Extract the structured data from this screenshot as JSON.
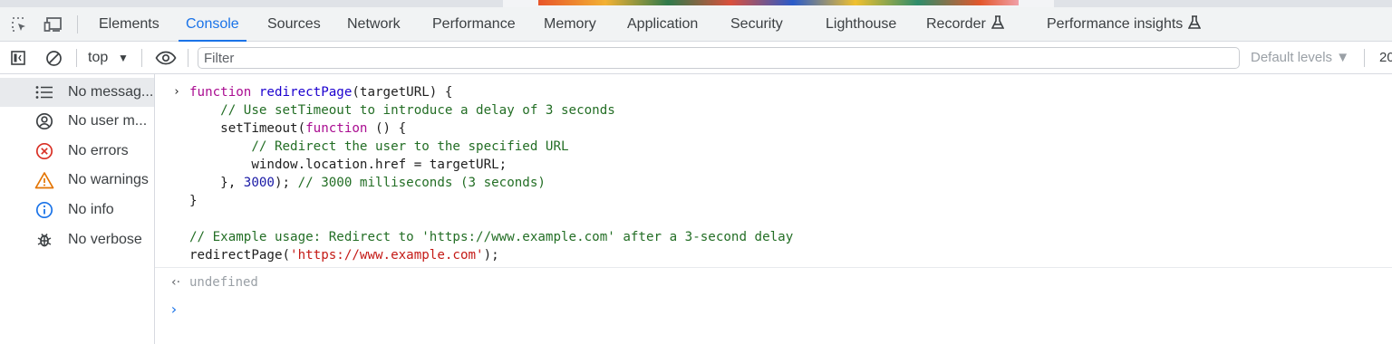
{
  "tabs": {
    "inspect_icon": "inspect-element-icon",
    "device_icon": "device-toolbar-icon",
    "items": [
      {
        "label": "Elements",
        "active": false
      },
      {
        "label": "Console",
        "active": true
      },
      {
        "label": "Sources",
        "active": false
      },
      {
        "label": "Network",
        "active": false
      },
      {
        "label": "Performance",
        "active": false
      },
      {
        "label": "Memory",
        "active": false
      },
      {
        "label": "Application",
        "active": false
      },
      {
        "label": "Security",
        "active": false
      },
      {
        "label": "Lighthouse",
        "active": false
      },
      {
        "label": "Recorder",
        "active": false,
        "icon": "flask-icon"
      },
      {
        "label": "Performance insights",
        "active": false,
        "icon": "flask-icon"
      }
    ]
  },
  "toolbar": {
    "context": "top",
    "filter_placeholder": "Filter",
    "levels": "Default levels ▼",
    "issues_count": "20"
  },
  "sidebar": {
    "items": [
      {
        "label": "No messag...",
        "icon": "list-icon",
        "selected": true
      },
      {
        "label": "No user m...",
        "icon": "user-icon",
        "selected": false
      },
      {
        "label": "No errors",
        "icon": "error-icon",
        "selected": false
      },
      {
        "label": "No warnings",
        "icon": "warning-icon",
        "selected": false
      },
      {
        "label": "No info",
        "icon": "info-icon",
        "selected": false
      },
      {
        "label": "No verbose",
        "icon": "bug-icon",
        "selected": false
      }
    ]
  },
  "console": {
    "input_lines": [
      [
        [
          "kw",
          "function "
        ],
        [
          "fn",
          "redirectPage"
        ],
        [
          "plain",
          "(targetURL) {"
        ]
      ],
      [
        [
          "plain",
          "    "
        ],
        [
          "cm",
          "// Use setTimeout to introduce a delay of 3 seconds"
        ]
      ],
      [
        [
          "plain",
          "    setTimeout("
        ],
        [
          "kw",
          "function"
        ],
        [
          "plain",
          " () {"
        ]
      ],
      [
        [
          "plain",
          "        "
        ],
        [
          "cm",
          "// Redirect the user to the specified URL"
        ]
      ],
      [
        [
          "plain",
          "        window.location.href = targetURL;"
        ]
      ],
      [
        [
          "plain",
          "    }, "
        ],
        [
          "num",
          "3000"
        ],
        [
          "plain",
          "); "
        ],
        [
          "cm",
          "// 3000 milliseconds (3 seconds)"
        ]
      ],
      [
        [
          "plain",
          "}"
        ]
      ],
      [
        [
          "plain",
          ""
        ]
      ],
      [
        [
          "cm",
          "// Example usage: Redirect to 'https://www.example.com' after a 3-second delay"
        ]
      ],
      [
        [
          "plain",
          "redirectPage("
        ],
        [
          "str",
          "'https://www.example.com'"
        ],
        [
          "plain",
          ");"
        ]
      ]
    ],
    "result": "undefined"
  },
  "colors": {
    "accent": "#1a73e8",
    "keyword": "#aa0d91",
    "function_name": "#1c00cf",
    "comment": "#236e25",
    "string": "#c41a16",
    "number": "#1a1aa6",
    "error": "#d93025",
    "warning": "#e37400"
  }
}
